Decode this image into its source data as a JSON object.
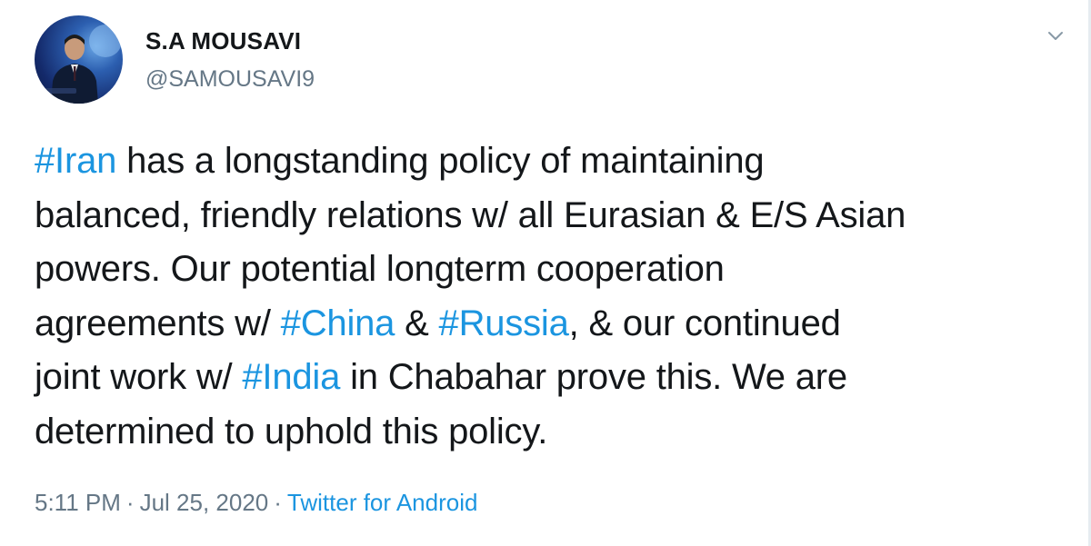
{
  "author": {
    "name": "S.A MOUSAVI",
    "handle": "@SAMOUSAVI9"
  },
  "icons": {
    "menu": "chevron-down-icon",
    "avatar": "profile-photo"
  },
  "tweet": {
    "lines": [
      [
        {
          "text": "#Iran",
          "type": "hashtag"
        },
        {
          "text": " has a longstanding policy of maintaining",
          "type": "text"
        }
      ],
      [
        {
          "text": "balanced, friendly relations w/ all Eurasian & E/S Asian",
          "type": "text"
        }
      ],
      [
        {
          "text": "powers. Our potential longterm cooperation",
          "type": "text"
        }
      ],
      [
        {
          "text": "agreements w/ ",
          "type": "text"
        },
        {
          "text": "#China",
          "type": "hashtag"
        },
        {
          "text": " & ",
          "type": "text"
        },
        {
          "text": "#Russia",
          "type": "hashtag"
        },
        {
          "text": ", & our continued",
          "type": "text"
        }
      ],
      [
        {
          "text": "joint work w/ ",
          "type": "text"
        },
        {
          "text": "#India",
          "type": "hashtag"
        },
        {
          "text": " in Chabahar prove this. We are",
          "type": "text"
        }
      ],
      [
        {
          "text": "determined to uphold this policy.",
          "type": "text"
        }
      ]
    ]
  },
  "meta": {
    "time": "5:11 PM",
    "separator": "·",
    "date": "Jul 25, 2020",
    "source": "Twitter for Android"
  },
  "colors": {
    "link": "#1b95e0",
    "secondary": "#657786",
    "text": "#14171a"
  }
}
